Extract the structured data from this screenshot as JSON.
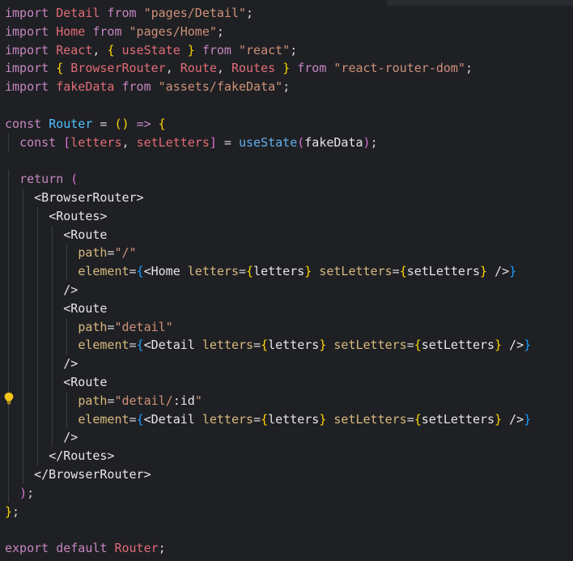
{
  "code": {
    "lines": [
      [
        {
          "t": "import",
          "c": "kw"
        },
        {
          "t": " "
        },
        {
          "t": "Detail",
          "c": "id"
        },
        {
          "t": " from ",
          "c": "kw"
        },
        {
          "t": "\"pages/Detail\"",
          "c": "str"
        },
        {
          "t": ";",
          "c": "punc"
        }
      ],
      [
        {
          "t": "import",
          "c": "kw"
        },
        {
          "t": " "
        },
        {
          "t": "Home",
          "c": "id"
        },
        {
          "t": " from ",
          "c": "kw"
        },
        {
          "t": "\"pages/Home\"",
          "c": "str"
        },
        {
          "t": ";",
          "c": "punc"
        }
      ],
      [
        {
          "t": "import",
          "c": "kw"
        },
        {
          "t": " "
        },
        {
          "t": "React",
          "c": "id"
        },
        {
          "t": ", ",
          "c": "punc"
        },
        {
          "t": "{",
          "c": "brace-y"
        },
        {
          "t": " "
        },
        {
          "t": "useState",
          "c": "id"
        },
        {
          "t": " "
        },
        {
          "t": "}",
          "c": "brace-y"
        },
        {
          "t": " from ",
          "c": "kw"
        },
        {
          "t": "\"react\"",
          "c": "str"
        },
        {
          "t": ";",
          "c": "punc"
        }
      ],
      [
        {
          "t": "import",
          "c": "kw"
        },
        {
          "t": " "
        },
        {
          "t": "{",
          "c": "brace-y"
        },
        {
          "t": " "
        },
        {
          "t": "BrowserRouter",
          "c": "id"
        },
        {
          "t": ", ",
          "c": "punc"
        },
        {
          "t": "Route",
          "c": "id"
        },
        {
          "t": ", ",
          "c": "punc"
        },
        {
          "t": "Routes",
          "c": "id"
        },
        {
          "t": " "
        },
        {
          "t": "}",
          "c": "brace-y"
        },
        {
          "t": " from ",
          "c": "kw"
        },
        {
          "t": "\"react-router-dom\"",
          "c": "str"
        },
        {
          "t": ";",
          "c": "punc"
        }
      ],
      [
        {
          "t": "import",
          "c": "kw"
        },
        {
          "t": " "
        },
        {
          "t": "fakeData",
          "c": "id"
        },
        {
          "t": " from ",
          "c": "kw"
        },
        {
          "t": "\"assets/fakeData\"",
          "c": "str"
        },
        {
          "t": ";",
          "c": "punc"
        }
      ],
      [],
      [
        {
          "t": "const",
          "c": "kw"
        },
        {
          "t": " "
        },
        {
          "t": "Router",
          "c": "fn"
        },
        {
          "t": " = ",
          "c": "punc"
        },
        {
          "t": "()",
          "c": "brace-y"
        },
        {
          "t": " "
        },
        {
          "t": "=>",
          "c": "arrow"
        },
        {
          "t": " "
        },
        {
          "t": "{",
          "c": "brace-y"
        }
      ],
      [
        {
          "t": "  "
        },
        {
          "t": "const",
          "c": "kw"
        },
        {
          "t": " "
        },
        {
          "t": "[",
          "c": "brace-p"
        },
        {
          "t": "letters",
          "c": "id"
        },
        {
          "t": ", ",
          "c": "punc"
        },
        {
          "t": "setLetters",
          "c": "id"
        },
        {
          "t": "]",
          "c": "brace-p"
        },
        {
          "t": " = ",
          "c": "punc"
        },
        {
          "t": "useState",
          "c": "fn2"
        },
        {
          "t": "(",
          "c": "brace-p"
        },
        {
          "t": "fakeData",
          "c": "var"
        },
        {
          "t": ")",
          "c": "brace-p"
        },
        {
          "t": ";",
          "c": "punc"
        }
      ],
      [],
      [
        {
          "t": "  "
        },
        {
          "t": "return",
          "c": "kw"
        },
        {
          "t": " "
        },
        {
          "t": "(",
          "c": "brace-p"
        }
      ],
      [
        {
          "t": "    "
        },
        {
          "t": "<BrowserRouter>",
          "c": "tag"
        }
      ],
      [
        {
          "t": "      "
        },
        {
          "t": "<Routes>",
          "c": "tag"
        }
      ],
      [
        {
          "t": "        "
        },
        {
          "t": "<Route",
          "c": "tag"
        }
      ],
      [
        {
          "t": "          "
        },
        {
          "t": "path",
          "c": "attr"
        },
        {
          "t": "=",
          "c": "punc"
        },
        {
          "t": "\"/\"",
          "c": "str"
        }
      ],
      [
        {
          "t": "          "
        },
        {
          "t": "element",
          "c": "attr"
        },
        {
          "t": "=",
          "c": "punc"
        },
        {
          "t": "{",
          "c": "brace-b"
        },
        {
          "t": "<Home",
          "c": "tag"
        },
        {
          "t": " "
        },
        {
          "t": "letters",
          "c": "attr"
        },
        {
          "t": "=",
          "c": "punc"
        },
        {
          "t": "{",
          "c": "brace-y"
        },
        {
          "t": "letters",
          "c": "var"
        },
        {
          "t": "}",
          "c": "brace-y"
        },
        {
          "t": " "
        },
        {
          "t": "setLetters",
          "c": "attr"
        },
        {
          "t": "=",
          "c": "punc"
        },
        {
          "t": "{",
          "c": "brace-y"
        },
        {
          "t": "setLetters",
          "c": "var"
        },
        {
          "t": "}",
          "c": "brace-y"
        },
        {
          "t": " />",
          "c": "tag"
        },
        {
          "t": "}",
          "c": "brace-b"
        }
      ],
      [
        {
          "t": "        "
        },
        {
          "t": "/>",
          "c": "tag"
        }
      ],
      [
        {
          "t": "        "
        },
        {
          "t": "<Route",
          "c": "tag"
        }
      ],
      [
        {
          "t": "          "
        },
        {
          "t": "path",
          "c": "attr"
        },
        {
          "t": "=",
          "c": "punc"
        },
        {
          "t": "\"detail\"",
          "c": "str"
        }
      ],
      [
        {
          "t": "          "
        },
        {
          "t": "element",
          "c": "attr"
        },
        {
          "t": "=",
          "c": "punc"
        },
        {
          "t": "{",
          "c": "brace-b"
        },
        {
          "t": "<Detail",
          "c": "tag"
        },
        {
          "t": " "
        },
        {
          "t": "letters",
          "c": "attr"
        },
        {
          "t": "=",
          "c": "punc"
        },
        {
          "t": "{",
          "c": "brace-y"
        },
        {
          "t": "letters",
          "c": "var"
        },
        {
          "t": "}",
          "c": "brace-y"
        },
        {
          "t": " "
        },
        {
          "t": "setLetters",
          "c": "attr"
        },
        {
          "t": "=",
          "c": "punc"
        },
        {
          "t": "{",
          "c": "brace-y"
        },
        {
          "t": "setLetters",
          "c": "var"
        },
        {
          "t": "}",
          "c": "brace-y"
        },
        {
          "t": " />",
          "c": "tag"
        },
        {
          "t": "}",
          "c": "brace-b"
        }
      ],
      [
        {
          "t": "        "
        },
        {
          "t": "/>",
          "c": "tag"
        }
      ],
      [
        {
          "t": "        "
        },
        {
          "t": "<Route",
          "c": "tag"
        }
      ],
      [
        {
          "t": "          "
        },
        {
          "t": "path",
          "c": "attr"
        },
        {
          "t": "=",
          "c": "punc"
        },
        {
          "t": "\"detail/",
          "c": "str"
        },
        {
          "t": ":id",
          "c": "var"
        },
        {
          "t": "\"",
          "c": "str"
        }
      ],
      [
        {
          "t": "          "
        },
        {
          "t": "element",
          "c": "attr"
        },
        {
          "t": "=",
          "c": "punc"
        },
        {
          "t": "{",
          "c": "brace-b"
        },
        {
          "t": "<Detail",
          "c": "tag"
        },
        {
          "t": " "
        },
        {
          "t": "letters",
          "c": "attr"
        },
        {
          "t": "=",
          "c": "punc"
        },
        {
          "t": "{",
          "c": "brace-y"
        },
        {
          "t": "letters",
          "c": "var"
        },
        {
          "t": "}",
          "c": "brace-y"
        },
        {
          "t": " "
        },
        {
          "t": "setLetters",
          "c": "attr"
        },
        {
          "t": "=",
          "c": "punc"
        },
        {
          "t": "{",
          "c": "brace-y"
        },
        {
          "t": "setLetters",
          "c": "var"
        },
        {
          "t": "}",
          "c": "brace-y"
        },
        {
          "t": " />",
          "c": "tag"
        },
        {
          "t": "}",
          "c": "brace-b"
        }
      ],
      [
        {
          "t": "        "
        },
        {
          "t": "/>",
          "c": "tag"
        }
      ],
      [
        {
          "t": "      "
        },
        {
          "t": "</Routes>",
          "c": "tag"
        }
      ],
      [
        {
          "t": "    "
        },
        {
          "t": "</BrowserRouter>",
          "c": "tag"
        }
      ],
      [
        {
          "t": "  "
        },
        {
          "t": ")",
          "c": "brace-p"
        },
        {
          "t": ";",
          "c": "punc"
        }
      ],
      [
        {
          "t": "}",
          "c": "brace-y"
        },
        {
          "t": ";",
          "c": "punc"
        }
      ],
      [],
      [
        {
          "t": "export",
          "c": "kw"
        },
        {
          "t": " "
        },
        {
          "t": "default",
          "c": "kw"
        },
        {
          "t": " "
        },
        {
          "t": "Router",
          "c": "id"
        },
        {
          "t": ";",
          "c": "punc"
        }
      ]
    ]
  },
  "icons": {
    "lightbulb": "lightbulb-icon"
  },
  "colors": {
    "background": "#1f2024",
    "keyword": "#c586c0",
    "identifier": "#e06c75",
    "string": "#ce9178",
    "attribute": "#d7ba7d",
    "bracket_gold": "#ffd700",
    "bracket_purple": "#da70d6",
    "bracket_blue": "#179fff",
    "function": "#4fc1ff",
    "lightbulb": "#f5c518"
  }
}
